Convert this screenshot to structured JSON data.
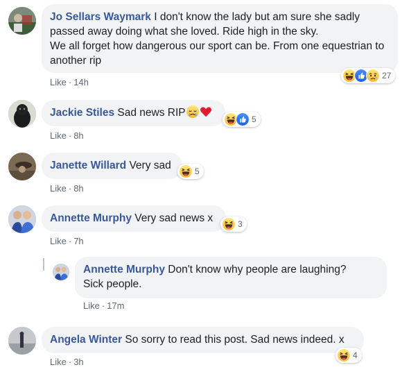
{
  "like_label": "Like",
  "separator": "·",
  "comments": [
    {
      "author": "Jo Sellars Waymark",
      "text": "I don't know the lady but am sure she sadly passed away doing what she loved. Ride high in the sky.\nWe all forget how dangerous our sport can be. From one equestrian to another rip",
      "time": "14h",
      "reaction_count": "27",
      "reactions": [
        "haha-icon",
        "like-icon",
        "sad-icon"
      ]
    },
    {
      "author": "Jackie Stiles",
      "text": "Sad news RIP",
      "inline_emoji": [
        "crying-face-icon",
        "red-heart-icon"
      ],
      "time": "8h",
      "reaction_count": "5",
      "reactions": [
        "haha-icon",
        "like-icon"
      ]
    },
    {
      "author": "Janette Willard",
      "text": "Very sad",
      "time": "8h",
      "reaction_count": "5",
      "reactions": [
        "haha-icon"
      ]
    },
    {
      "author": "Annette Murphy",
      "text": "Very sad news x",
      "time": "7h",
      "reaction_count": "3",
      "reactions": [
        "haha-icon"
      ]
    },
    {
      "author": "Annette Murphy",
      "text": "Don't know why people are laughing?\nSick people.",
      "time": "17m",
      "is_reply": true
    },
    {
      "author": "Angela Winter",
      "text": "So sorry to read this post. Sad news indeed. x",
      "time": "3h",
      "reaction_count": "4",
      "reactions": [
        "haha-icon"
      ]
    }
  ]
}
